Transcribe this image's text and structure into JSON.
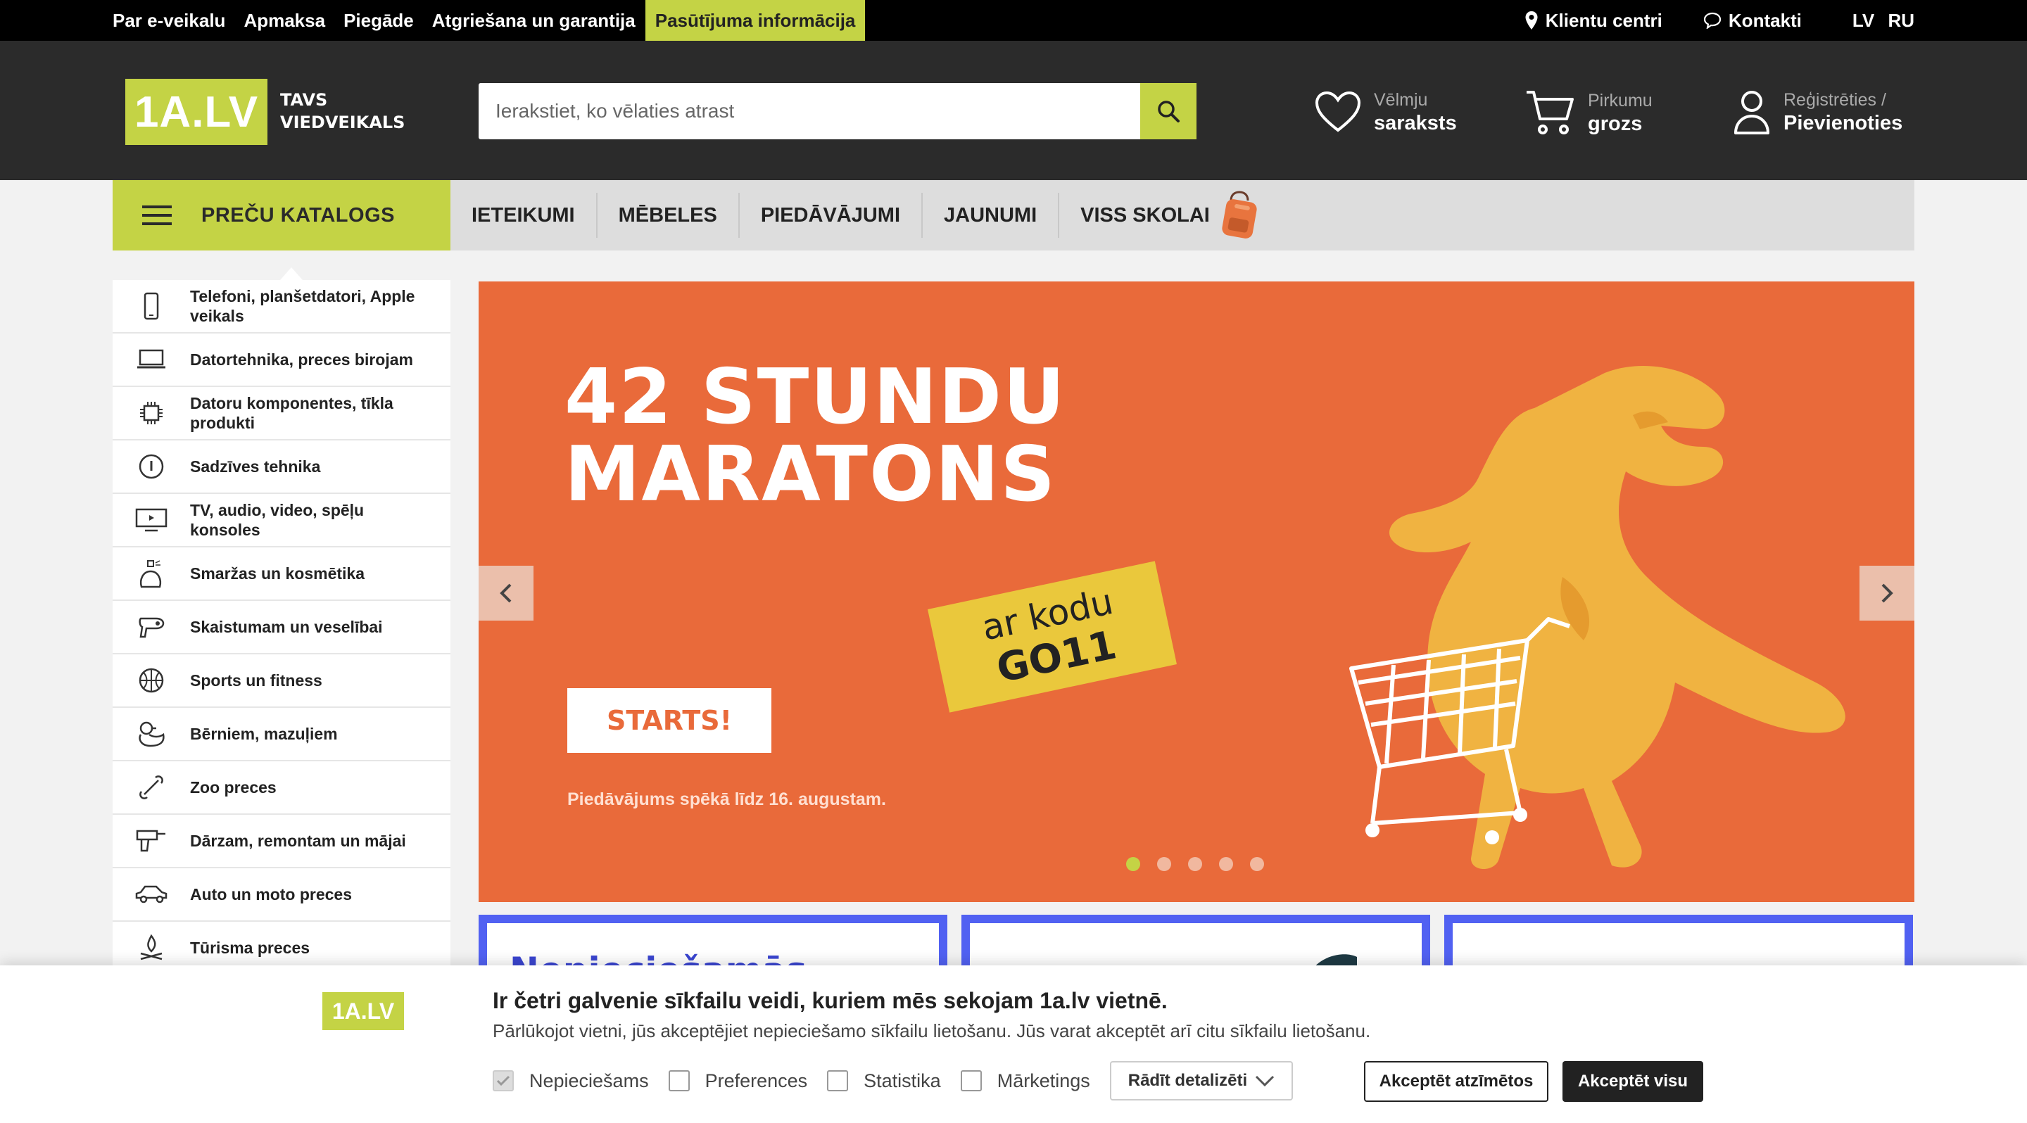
{
  "topbar": {
    "links": [
      "Par e-veikalu",
      "Apmaksa",
      "Piegāde",
      "Atgriešana un garantija",
      "Pasūtījuma informācija"
    ],
    "client_centers": "Klientu centri",
    "contacts": "Kontakti",
    "lang_lv": "LV",
    "lang_ru": "RU"
  },
  "header": {
    "logo": "1A.LV",
    "tagline_1": "TAVS",
    "tagline_2": "VIEDVEIKALS",
    "search_placeholder": "Ierakstiet, ko vēlaties atrast",
    "wishlist_1": "Vēlmju",
    "wishlist_2": "saraksts",
    "cart_1": "Pirkumu",
    "cart_2": "grozs",
    "account_1": "Reģistrēties /",
    "account_2": "Pievienoties"
  },
  "nav": {
    "catalog": "PREČU KATALOGS",
    "links": [
      "IETEIKUMI",
      "MĒBELES",
      "PIEDĀVĀJUMI",
      "JAUNUMI",
      "VISS SKOLAI"
    ]
  },
  "sidemenu": {
    "items": [
      {
        "label": "Telefoni, planšetdatori, Apple veikals",
        "icon": "phone-icon"
      },
      {
        "label": "Datortehnika, preces birojam",
        "icon": "laptop-icon"
      },
      {
        "label": "Datoru komponentes, tīkla produkti",
        "icon": "chip-icon"
      },
      {
        "label": "Sadzīves tehnika",
        "icon": "appliance-icon"
      },
      {
        "label": "TV, audio, video, spēļu konsoles",
        "icon": "tv-icon"
      },
      {
        "label": "Smaržas un kosmētika",
        "icon": "perfume-icon"
      },
      {
        "label": "Skaistumam un veselībai",
        "icon": "hairdryer-icon"
      },
      {
        "label": "Sports un fitness",
        "icon": "ball-icon"
      },
      {
        "label": "Bērniem, mazuļiem",
        "icon": "duck-icon"
      },
      {
        "label": "Zoo preces",
        "icon": "bone-icon"
      },
      {
        "label": "Dārzam, remontam un mājai",
        "icon": "drill-icon"
      },
      {
        "label": "Auto un moto preces",
        "icon": "car-icon"
      },
      {
        "label": "Tūrisma preces",
        "icon": "campfire-icon"
      }
    ]
  },
  "banner": {
    "title_1": "42 STUNDU",
    "title_2": "MARATONS",
    "code_1": "ar kodu",
    "code_2": "GO11",
    "cta": "STARTS!",
    "note": "Piedāvājums spēkā līdz 16. augustam.",
    "slide_count": 5,
    "active_slide": 1
  },
  "tiles": {
    "first_title": "Nepieciešamās"
  },
  "cookie": {
    "logo": "1A.LV",
    "title": "Ir četri galvenie sīkfailu veidi, kuriem mēs sekojam 1a.lv vietnē.",
    "desc": "Pārlūkojot vietni, jūs akceptējiet nepieciešamo sīkfailu lietošanu. Jūs varat akceptēt arī citu sīkfailu lietošanu.",
    "opt_necessary": "Nepieciešams",
    "opt_preferences": "Preferences",
    "opt_statistics": "Statistika",
    "opt_marketing": "Mārketings",
    "details": "Rādīt detalizēti",
    "accept_selected": "Akceptēt atzīmētos",
    "accept_all": "Akceptēt visu"
  },
  "colors": {
    "brand_green": "#c4d345",
    "banner_orange": "#e96a3a",
    "header_dark": "#2b2b2b",
    "tile_blue": "#5161f2"
  }
}
